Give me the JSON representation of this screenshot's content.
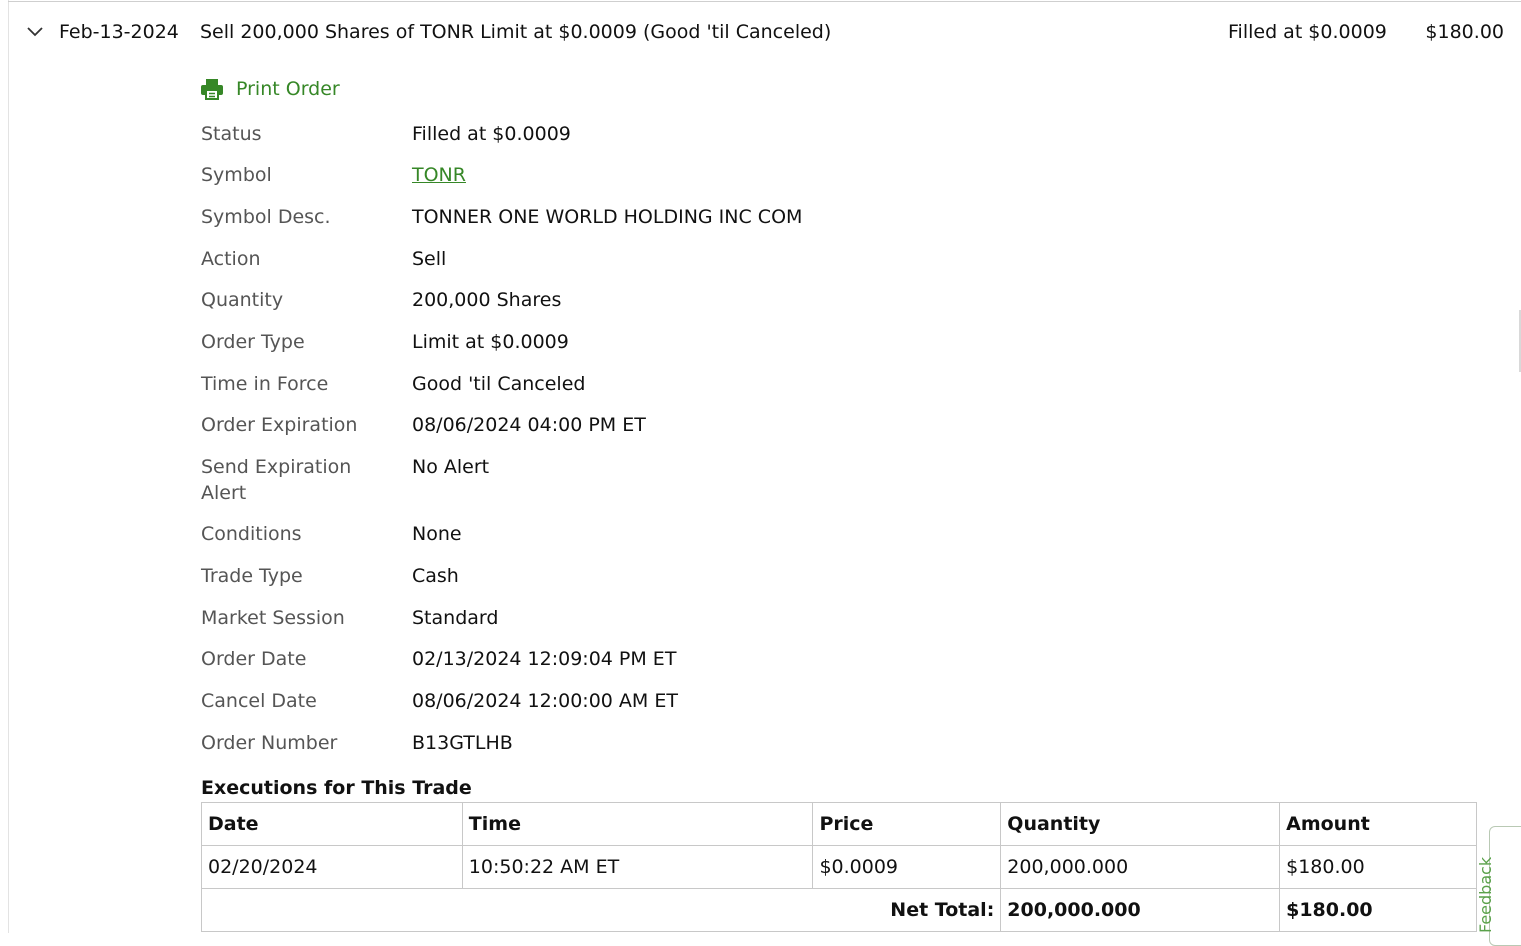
{
  "order": {
    "date": "Feb-13-2024",
    "description": "Sell 200,000 Shares of TONR Limit at $0.0009 (Good 'til Canceled)",
    "status": "Filled at $0.0009",
    "amount": "$180.00"
  },
  "actions": {
    "print_label": "Print Order"
  },
  "details": [
    {
      "label": "Status",
      "value": "Filled at $0.0009"
    },
    {
      "label": "Symbol",
      "value": "TONR",
      "link": true
    },
    {
      "label": "Symbol Desc.",
      "value": "TONNER ONE WORLD HOLDING INC COM"
    },
    {
      "label": "Action",
      "value": "Sell"
    },
    {
      "label": "Quantity",
      "value": "200,000 Shares"
    },
    {
      "label": "Order Type",
      "value": "Limit at $0.0009"
    },
    {
      "label": "Time in Force",
      "value": "Good 'til Canceled"
    },
    {
      "label": "Order Expiration",
      "value": "08/06/2024 04:00 PM ET"
    },
    {
      "label": "Send Expiration Alert",
      "value": "No Alert"
    },
    {
      "label": "Conditions",
      "value": "None"
    },
    {
      "label": "Trade Type",
      "value": "Cash"
    },
    {
      "label": "Market Session",
      "value": "Standard"
    },
    {
      "label": "Order Date",
      "value": "02/13/2024 12:09:04 PM ET"
    },
    {
      "label": "Cancel Date",
      "value": "08/06/2024 12:00:00 AM ET"
    },
    {
      "label": "Order Number",
      "value": "B13GTLHB"
    }
  ],
  "executions": {
    "title": "Executions for This Trade",
    "columns": [
      "Date",
      "Time",
      "Price",
      "Quantity",
      "Amount"
    ],
    "rows": [
      [
        "02/20/2024",
        "10:50:22 AM ET",
        "$0.0009",
        "200,000.000",
        "$180.00"
      ]
    ],
    "net_total_label": "Net Total:",
    "net_total_quantity": "200,000.000",
    "net_total_amount": "$180.00"
  },
  "feedback_label": "Feedback",
  "colors": {
    "accent": "#368727",
    "label": "#555555"
  },
  "icons": {
    "expand": "chevron-down-icon",
    "print": "printer-icon"
  }
}
